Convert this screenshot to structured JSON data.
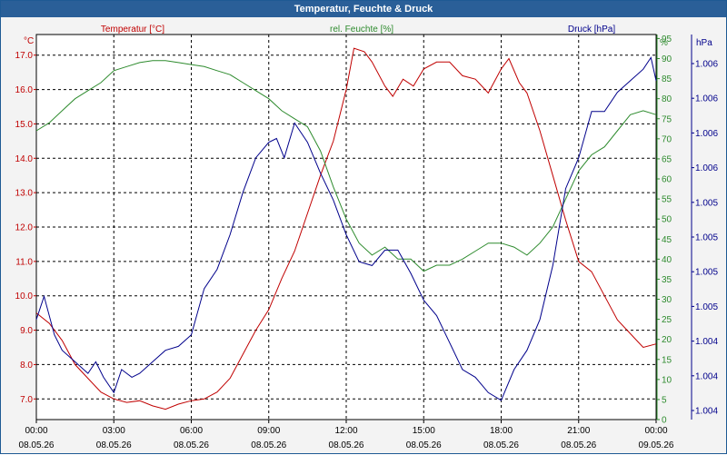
{
  "window": {
    "title": "Temperatur, Feuchte & Druck"
  },
  "chart_data": {
    "type": "line",
    "title": "Temperatur, Feuchte & Druck",
    "grid": true,
    "x_ticks": [
      {
        "time": "00:00",
        "date": "08.05.26"
      },
      {
        "time": "03:00",
        "date": "08.05.26"
      },
      {
        "time": "06:00",
        "date": "08.05.26"
      },
      {
        "time": "09:00",
        "date": "08.05.26"
      },
      {
        "time": "12:00",
        "date": "08.05.26"
      },
      {
        "time": "15:00",
        "date": "08.05.26"
      },
      {
        "time": "18:00",
        "date": "08.05.26"
      },
      {
        "time": "21:00",
        "date": "08.05.26"
      },
      {
        "time": "00:00",
        "date": "09.05.26"
      }
    ],
    "xlim": [
      0,
      24
    ],
    "axes": {
      "temperature": {
        "label": "Temperatur [°C]",
        "unit": "°C",
        "color": "#c00000",
        "min": 6.4,
        "max": 17.6,
        "ticks": [
          "7.0",
          "8.0",
          "9.0",
          "10.0",
          "11.0",
          "12.0",
          "13.0",
          "14.0",
          "15.0",
          "16.0",
          "17.0"
        ]
      },
      "humidity": {
        "label": "rel. Feuchte [%]",
        "unit": "%",
        "color": "#2e8b2e",
        "min": 0,
        "max": 96,
        "ticks": [
          "0",
          "5",
          "10",
          "15",
          "20",
          "25",
          "30",
          "35",
          "40",
          "45",
          "50",
          "55",
          "60",
          "65",
          "70",
          "75",
          "80",
          "85",
          "90",
          "95"
        ]
      },
      "pressure": {
        "label": "Druck [hPa]",
        "unit": "hPa",
        "color": "#00008b",
        "min": 0,
        "max": 1,
        "ticks": [
          "1.004",
          "1.004",
          "1.004",
          "1.005",
          "1.005",
          "1.005",
          "1.005",
          "1.006",
          "1.006",
          "1.006",
          "1.006"
        ]
      }
    },
    "series": [
      {
        "name": "Temperatur [°C]",
        "axis": "temperature",
        "color": "#c00000",
        "points": [
          [
            0,
            9.5
          ],
          [
            0.5,
            9.2
          ],
          [
            1,
            8.7
          ],
          [
            1.5,
            8.0
          ],
          [
            2,
            7.6
          ],
          [
            2.5,
            7.2
          ],
          [
            3,
            7.0
          ],
          [
            3.5,
            6.9
          ],
          [
            4,
            6.95
          ],
          [
            4.5,
            6.8
          ],
          [
            5,
            6.7
          ],
          [
            5.5,
            6.85
          ],
          [
            6,
            6.95
          ],
          [
            6.5,
            7.0
          ],
          [
            7,
            7.2
          ],
          [
            7.5,
            7.6
          ],
          [
            8,
            8.3
          ],
          [
            8.5,
            9.0
          ],
          [
            9,
            9.6
          ],
          [
            9.5,
            10.5
          ],
          [
            10,
            11.3
          ],
          [
            10.5,
            12.4
          ],
          [
            11,
            13.5
          ],
          [
            11.5,
            14.5
          ],
          [
            12,
            16.0
          ],
          [
            12.3,
            17.2
          ],
          [
            12.7,
            17.1
          ],
          [
            13,
            16.8
          ],
          [
            13.5,
            16.1
          ],
          [
            13.8,
            15.8
          ],
          [
            14.2,
            16.3
          ],
          [
            14.6,
            16.1
          ],
          [
            15,
            16.6
          ],
          [
            15.5,
            16.8
          ],
          [
            16,
            16.8
          ],
          [
            16.5,
            16.4
          ],
          [
            17,
            16.3
          ],
          [
            17.5,
            15.9
          ],
          [
            18,
            16.6
          ],
          [
            18.3,
            16.9
          ],
          [
            18.7,
            16.2
          ],
          [
            19,
            15.9
          ],
          [
            19.5,
            14.8
          ],
          [
            20,
            13.5
          ],
          [
            20.5,
            12.2
          ],
          [
            21,
            11.0
          ],
          [
            21.5,
            10.7
          ],
          [
            22,
            10.0
          ],
          [
            22.5,
            9.3
          ],
          [
            23,
            8.9
          ],
          [
            23.5,
            8.5
          ],
          [
            24,
            8.6
          ]
        ]
      },
      {
        "name": "rel. Feuchte [%]",
        "axis": "humidity",
        "color": "#2e8b2e",
        "points": [
          [
            0,
            72
          ],
          [
            0.5,
            74
          ],
          [
            1,
            77
          ],
          [
            1.5,
            80
          ],
          [
            2,
            82
          ],
          [
            2.5,
            84
          ],
          [
            3,
            87
          ],
          [
            3.5,
            88
          ],
          [
            4,
            89
          ],
          [
            4.5,
            89.5
          ],
          [
            5,
            89.5
          ],
          [
            5.5,
            89
          ],
          [
            6,
            88.5
          ],
          [
            6.5,
            88
          ],
          [
            7,
            87
          ],
          [
            7.5,
            86
          ],
          [
            8,
            84
          ],
          [
            8.5,
            82
          ],
          [
            9,
            80
          ],
          [
            9.5,
            77
          ],
          [
            10,
            75
          ],
          [
            10.5,
            73
          ],
          [
            11,
            67
          ],
          [
            11.5,
            58
          ],
          [
            12,
            50
          ],
          [
            12.5,
            44
          ],
          [
            13,
            41
          ],
          [
            13.5,
            43
          ],
          [
            14,
            40
          ],
          [
            14.5,
            40
          ],
          [
            15,
            37
          ],
          [
            15.5,
            38.5
          ],
          [
            16,
            38.5
          ],
          [
            16.5,
            40
          ],
          [
            17,
            42
          ],
          [
            17.5,
            44
          ],
          [
            18,
            44
          ],
          [
            18.5,
            43
          ],
          [
            19,
            41
          ],
          [
            19.5,
            44
          ],
          [
            20,
            48
          ],
          [
            20.5,
            55
          ],
          [
            21,
            62
          ],
          [
            21.5,
            66
          ],
          [
            22,
            68
          ],
          [
            22.5,
            72
          ],
          [
            23,
            76
          ],
          [
            23.5,
            77
          ],
          [
            24,
            76
          ]
        ]
      },
      {
        "name": "Druck [hPa]",
        "axis": "pressure",
        "color": "#00008b",
        "points": [
          [
            0,
            0.26
          ],
          [
            0.3,
            0.32
          ],
          [
            0.7,
            0.22
          ],
          [
            1,
            0.18
          ],
          [
            1.5,
            0.15
          ],
          [
            2,
            0.12
          ],
          [
            2.3,
            0.15
          ],
          [
            2.6,
            0.11
          ],
          [
            3,
            0.07
          ],
          [
            3.3,
            0.13
          ],
          [
            3.7,
            0.11
          ],
          [
            4,
            0.12
          ],
          [
            4.5,
            0.15
          ],
          [
            5,
            0.18
          ],
          [
            5.5,
            0.19
          ],
          [
            6,
            0.22
          ],
          [
            6.5,
            0.34
          ],
          [
            7,
            0.39
          ],
          [
            7.5,
            0.48
          ],
          [
            8,
            0.59
          ],
          [
            8.5,
            0.68
          ],
          [
            9,
            0.72
          ],
          [
            9.3,
            0.73
          ],
          [
            9.6,
            0.68
          ],
          [
            10,
            0.77
          ],
          [
            10.5,
            0.72
          ],
          [
            11,
            0.64
          ],
          [
            11.5,
            0.57
          ],
          [
            12,
            0.48
          ],
          [
            12.5,
            0.41
          ],
          [
            13,
            0.4
          ],
          [
            13.5,
            0.44
          ],
          [
            14,
            0.44
          ],
          [
            14.5,
            0.38
          ],
          [
            15,
            0.31
          ],
          [
            15.5,
            0.27
          ],
          [
            16,
            0.2
          ],
          [
            16.5,
            0.13
          ],
          [
            17,
            0.11
          ],
          [
            17.5,
            0.07
          ],
          [
            18,
            0.05
          ],
          [
            18.5,
            0.13
          ],
          [
            19,
            0.18
          ],
          [
            19.5,
            0.26
          ],
          [
            20,
            0.4
          ],
          [
            20.5,
            0.6
          ],
          [
            21,
            0.68
          ],
          [
            21.5,
            0.8
          ],
          [
            22,
            0.8
          ],
          [
            22.5,
            0.85
          ],
          [
            23,
            0.88
          ],
          [
            23.5,
            0.91
          ],
          [
            23.8,
            0.94
          ],
          [
            24,
            0.88
          ]
        ]
      }
    ]
  }
}
